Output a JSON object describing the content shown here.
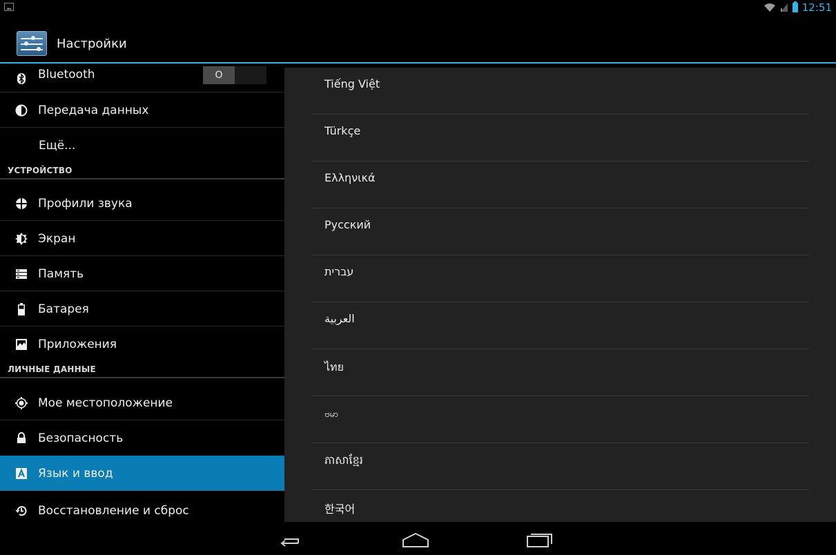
{
  "status_bar": {
    "time": "12:51",
    "icons": [
      "gallery-icon",
      "wifi-icon",
      "signal-icon",
      "battery-icon"
    ]
  },
  "action_bar": {
    "title": "Настройки",
    "icon": "settings-sliders-icon"
  },
  "settings_list": {
    "items": [
      {
        "label": "Bluetooth",
        "icon": "bluetooth-icon",
        "toggle": "O"
      },
      {
        "label": "Передача данных",
        "icon": "data-usage-icon"
      },
      {
        "label": "Ещё...",
        "icon": ""
      },
      {
        "section": "УСТРОЙСТВО"
      },
      {
        "label": "Профили звука",
        "icon": "sound-icon"
      },
      {
        "label": "Экран",
        "icon": "display-icon"
      },
      {
        "label": "Память",
        "icon": "storage-icon"
      },
      {
        "label": "Батарея",
        "icon": "battery-icon"
      },
      {
        "label": "Приложения",
        "icon": "apps-icon"
      },
      {
        "section": "ЛИЧНЫЕ ДАННЫЕ"
      },
      {
        "label": "Мое местоположение",
        "icon": "location-icon"
      },
      {
        "label": "Безопасность",
        "icon": "lock-icon"
      },
      {
        "label": "Язык и ввод",
        "icon": "language-icon",
        "selected": true
      },
      {
        "label": "Восстановление и сброс",
        "icon": "restore-icon"
      }
    ]
  },
  "languages": [
    "Tiếng Việt",
    "Türkçe",
    "Ελληνικά",
    "Русский",
    "עברית",
    "العربية",
    "ไทย",
    "ဗမာ",
    "ភាសាខ្មែរ",
    "한국어"
  ],
  "colors": {
    "accent": "#33b5e5",
    "selected_row": "#0b7db5",
    "pane_bg": "#222222"
  },
  "nav_bar": {
    "buttons": [
      "back-icon",
      "home-icon",
      "recents-icon"
    ]
  }
}
